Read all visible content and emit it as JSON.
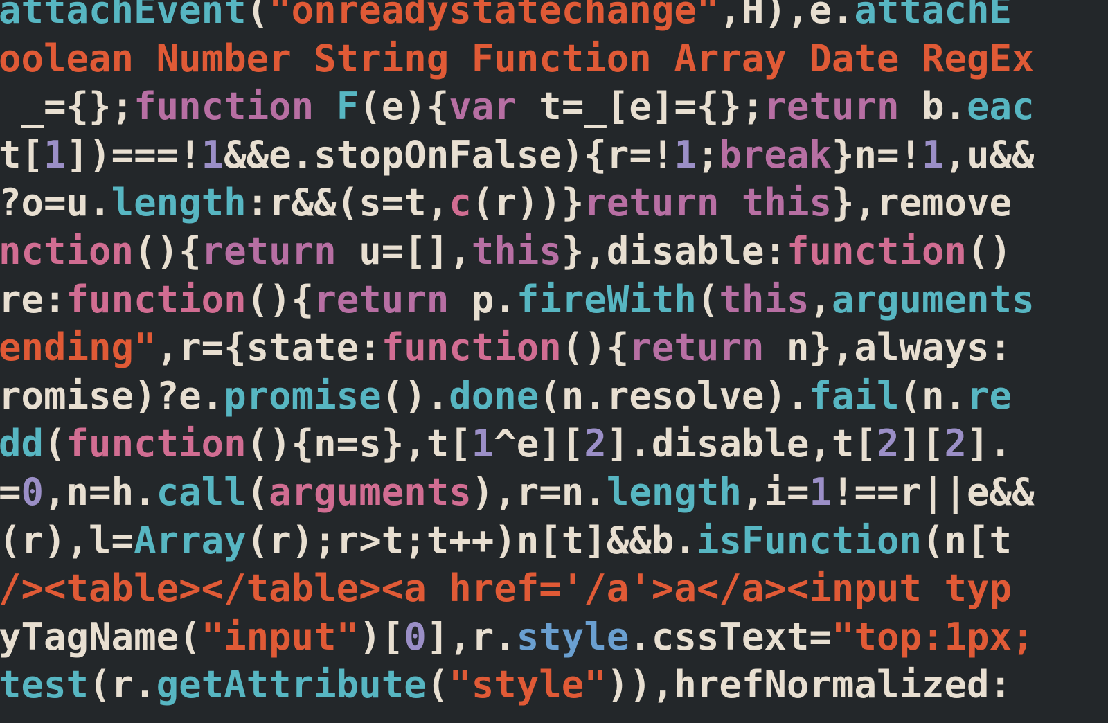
{
  "lines": [
    {
      "tokens": [
        {
          "cls": "t-cyan",
          "text": "attachEvent"
        },
        {
          "cls": "t-default",
          "text": "("
        },
        {
          "cls": "t-orange",
          "text": "\"onreadystatechange\""
        },
        {
          "cls": "t-default",
          "text": ",H),e."
        },
        {
          "cls": "t-cyan",
          "text": "attachE"
        }
      ]
    },
    {
      "tokens": [
        {
          "cls": "t-orange",
          "text": "oolean Number String Function Array Date RegEx"
        }
      ]
    },
    {
      "tokens": [
        {
          "cls": "t-default",
          "text": " _={};"
        },
        {
          "cls": "t-magenta",
          "text": "function"
        },
        {
          "cls": "t-default",
          "text": " "
        },
        {
          "cls": "t-cyan",
          "text": "F"
        },
        {
          "cls": "t-default",
          "text": "(e){"
        },
        {
          "cls": "t-magenta",
          "text": "var"
        },
        {
          "cls": "t-default",
          "text": " t=_[e]={};"
        },
        {
          "cls": "t-magenta",
          "text": "return"
        },
        {
          "cls": "t-default",
          "text": " b."
        },
        {
          "cls": "t-cyan",
          "text": "eac"
        }
      ]
    },
    {
      "tokens": [
        {
          "cls": "t-default",
          "text": "t["
        },
        {
          "cls": "t-lav",
          "text": "1"
        },
        {
          "cls": "t-default",
          "text": "])===!"
        },
        {
          "cls": "t-lav",
          "text": "1"
        },
        {
          "cls": "t-default",
          "text": "&&e.stopOnFalse){r=!"
        },
        {
          "cls": "t-lav",
          "text": "1"
        },
        {
          "cls": "t-default",
          "text": ";"
        },
        {
          "cls": "t-magenta",
          "text": "break"
        },
        {
          "cls": "t-default",
          "text": "}n=!"
        },
        {
          "cls": "t-lav",
          "text": "1"
        },
        {
          "cls": "t-default",
          "text": ",u&&"
        }
      ]
    },
    {
      "tokens": [
        {
          "cls": "t-default",
          "text": "?o=u."
        },
        {
          "cls": "t-cyan",
          "text": "length"
        },
        {
          "cls": "t-default",
          "text": ":r&&(s=t,"
        },
        {
          "cls": "t-pink",
          "text": "c"
        },
        {
          "cls": "t-default",
          "text": "(r))}"
        },
        {
          "cls": "t-magenta",
          "text": "return"
        },
        {
          "cls": "t-default",
          "text": " "
        },
        {
          "cls": "t-magenta",
          "text": "this"
        },
        {
          "cls": "t-default",
          "text": "},remove"
        }
      ]
    },
    {
      "tokens": [
        {
          "cls": "t-pink",
          "text": "nction"
        },
        {
          "cls": "t-default",
          "text": "(){"
        },
        {
          "cls": "t-magenta",
          "text": "return"
        },
        {
          "cls": "t-default",
          "text": " u=[],"
        },
        {
          "cls": "t-magenta",
          "text": "this"
        },
        {
          "cls": "t-default",
          "text": "},disable:"
        },
        {
          "cls": "t-pink",
          "text": "function"
        },
        {
          "cls": "t-default",
          "text": "()"
        }
      ]
    },
    {
      "tokens": [
        {
          "cls": "t-default",
          "text": "re:"
        },
        {
          "cls": "t-pink",
          "text": "function"
        },
        {
          "cls": "t-default",
          "text": "(){"
        },
        {
          "cls": "t-magenta",
          "text": "return"
        },
        {
          "cls": "t-default",
          "text": " p."
        },
        {
          "cls": "t-cyan",
          "text": "fireWith"
        },
        {
          "cls": "t-default",
          "text": "("
        },
        {
          "cls": "t-magenta",
          "text": "this"
        },
        {
          "cls": "t-default",
          "text": ","
        },
        {
          "cls": "t-cyan",
          "text": "arguments"
        }
      ]
    },
    {
      "tokens": [
        {
          "cls": "t-orange",
          "text": "ending\""
        },
        {
          "cls": "t-default",
          "text": ",r={state:"
        },
        {
          "cls": "t-pink",
          "text": "function"
        },
        {
          "cls": "t-default",
          "text": "(){"
        },
        {
          "cls": "t-magenta",
          "text": "return"
        },
        {
          "cls": "t-default",
          "text": " n},always:"
        }
      ]
    },
    {
      "tokens": [
        {
          "cls": "t-default",
          "text": "romise)?e."
        },
        {
          "cls": "t-cyan",
          "text": "promise"
        },
        {
          "cls": "t-default",
          "text": "()."
        },
        {
          "cls": "t-cyan",
          "text": "done"
        },
        {
          "cls": "t-default",
          "text": "(n.resolve)."
        },
        {
          "cls": "t-cyan",
          "text": "fail"
        },
        {
          "cls": "t-default",
          "text": "(n."
        },
        {
          "cls": "t-cyan",
          "text": "re"
        }
      ]
    },
    {
      "tokens": [
        {
          "cls": "t-cyan",
          "text": "dd"
        },
        {
          "cls": "t-default",
          "text": "("
        },
        {
          "cls": "t-pink",
          "text": "function"
        },
        {
          "cls": "t-default",
          "text": "(){n=s},t["
        },
        {
          "cls": "t-lav",
          "text": "1"
        },
        {
          "cls": "t-default",
          "text": "^e]["
        },
        {
          "cls": "t-lav",
          "text": "2"
        },
        {
          "cls": "t-default",
          "text": "].disable,t["
        },
        {
          "cls": "t-lav",
          "text": "2"
        },
        {
          "cls": "t-default",
          "text": "]["
        },
        {
          "cls": "t-lav",
          "text": "2"
        },
        {
          "cls": "t-default",
          "text": "]."
        }
      ]
    },
    {
      "tokens": [
        {
          "cls": "t-default",
          "text": "="
        },
        {
          "cls": "t-lav",
          "text": "0"
        },
        {
          "cls": "t-default",
          "text": ",n=h."
        },
        {
          "cls": "t-cyan",
          "text": "call"
        },
        {
          "cls": "t-default",
          "text": "("
        },
        {
          "cls": "t-pink",
          "text": "arguments"
        },
        {
          "cls": "t-default",
          "text": "),r=n."
        },
        {
          "cls": "t-cyan",
          "text": "length"
        },
        {
          "cls": "t-default",
          "text": ",i="
        },
        {
          "cls": "t-lav",
          "text": "1"
        },
        {
          "cls": "t-default",
          "text": "!==r||e&&"
        }
      ]
    },
    {
      "tokens": [
        {
          "cls": "t-default",
          "text": "(r),l="
        },
        {
          "cls": "t-cyan",
          "text": "Array"
        },
        {
          "cls": "t-default",
          "text": "(r);r>t;t++)n[t]&&b."
        },
        {
          "cls": "t-cyan",
          "text": "isFunction"
        },
        {
          "cls": "t-default",
          "text": "(n[t"
        }
      ]
    },
    {
      "tokens": [
        {
          "cls": "t-orange",
          "text": "/><table></table><a href='/a'>a</a><input typ"
        }
      ]
    },
    {
      "tokens": [
        {
          "cls": "t-default",
          "text": "yTagName("
        },
        {
          "cls": "t-orange",
          "text": "\"input\""
        },
        {
          "cls": "t-default",
          "text": ")["
        },
        {
          "cls": "t-lav",
          "text": "0"
        },
        {
          "cls": "t-default",
          "text": "],r."
        },
        {
          "cls": "t-blue",
          "text": "style"
        },
        {
          "cls": "t-default",
          "text": ".cssText="
        },
        {
          "cls": "t-orange",
          "text": "\"top:1px;"
        }
      ]
    },
    {
      "tokens": [
        {
          "cls": "t-cyan",
          "text": "test"
        },
        {
          "cls": "t-default",
          "text": "(r."
        },
        {
          "cls": "t-cyan",
          "text": "getAttribute"
        },
        {
          "cls": "t-default",
          "text": "("
        },
        {
          "cls": "t-orange",
          "text": "\"style\""
        },
        {
          "cls": "t-default",
          "text": ")),hrefNormalized:"
        }
      ]
    }
  ]
}
